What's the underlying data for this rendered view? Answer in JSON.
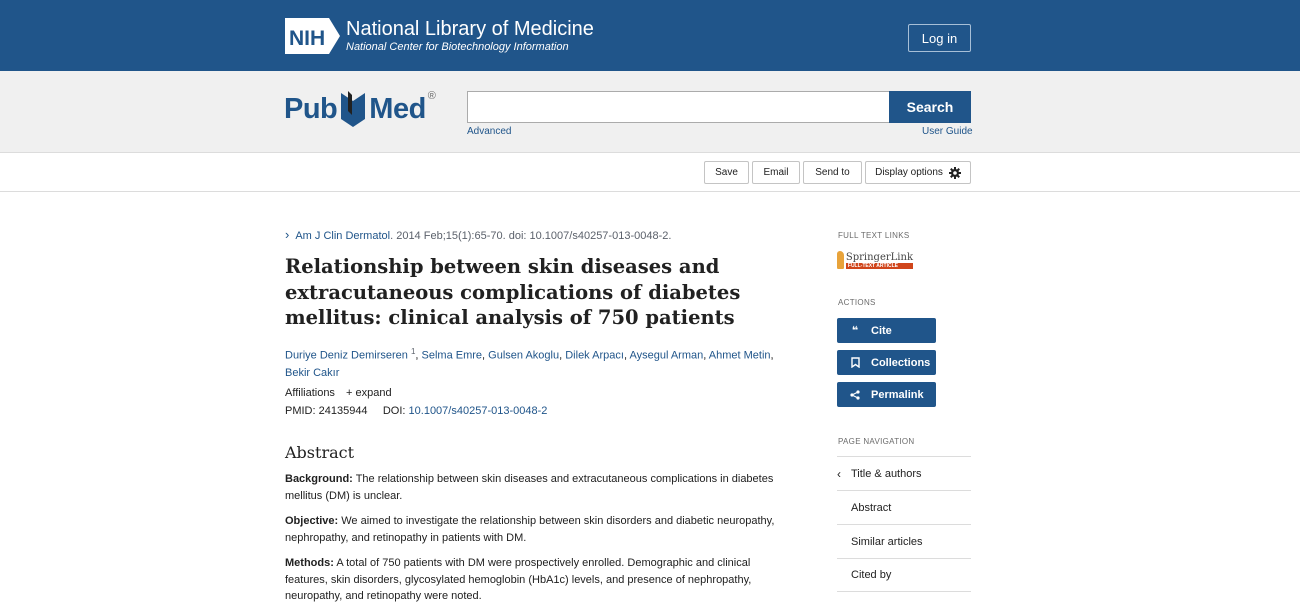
{
  "header": {
    "nih_badge": "NIH",
    "nih_title": "National Library of Medicine",
    "nih_subtitle": "National Center for Biotechnology Information",
    "login_label": "Log in"
  },
  "search": {
    "logo_pub": "Pub",
    "logo_med": "Med",
    "logo_reg": "®",
    "placeholder": "",
    "button_label": "Search",
    "advanced_label": "Advanced",
    "user_guide_label": "User Guide"
  },
  "toolbar": {
    "save_label": "Save",
    "email_label": "Email",
    "send_to_label": "Send to",
    "display_options_label": "Display options"
  },
  "article": {
    "journal": "Am J Clin Dermatol",
    "citation": ". 2014 Feb;15(1):65-70. doi: 10.1007/s40257-013-0048-2.",
    "title": "Relationship between skin diseases and extracutaneous complications of diabetes mellitus: clinical analysis of 750 patients",
    "authors": [
      {
        "name": "Duriye Deniz Demirseren",
        "sup": "1"
      },
      {
        "name": "Selma Emre"
      },
      {
        "name": "Gulsen Akoglu"
      },
      {
        "name": "Dilek Arpacı"
      },
      {
        "name": "Aysegul Arman"
      },
      {
        "name": "Ahmet Metin"
      },
      {
        "name": "Bekir Cakır"
      }
    ],
    "affiliations_label": "Affiliations",
    "expand_label": "+ expand",
    "pmid_label": "PMID: 24135944",
    "doi_label": "DOI:",
    "doi_value": "10.1007/s40257-013-0048-2"
  },
  "abstract": {
    "heading": "Abstract",
    "background_label": "Background:",
    "background_text": " The relationship between skin diseases and extracutaneous complications in diabetes mellitus (DM) is unclear.",
    "objective_label": "Objective:",
    "objective_text": " We aimed to investigate the relationship between skin disorders and diabetic neuropathy, nephropathy, and retinopathy in patients with DM.",
    "methods_label": "Methods:",
    "methods_text": " A total of 750 patients with DM were prospectively enrolled. Demographic and clinical features, skin disorders, glycosylated hemoglobin (HbA1c) levels, and presence of nephropathy, neuropathy, and retinopathy were noted."
  },
  "sidebar": {
    "full_text_heading": "FULL TEXT LINKS",
    "springer_name": "SpringerLink",
    "springer_tag": "FULL-TEXT ARTICLE",
    "actions_heading": "ACTIONS",
    "cite_label": "Cite",
    "collections_label": "Collections",
    "permalink_label": "Permalink",
    "page_nav_heading": "PAGE NAVIGATION",
    "nav_items": [
      "Title & authors",
      "Abstract",
      "Similar articles",
      "Cited by"
    ]
  }
}
